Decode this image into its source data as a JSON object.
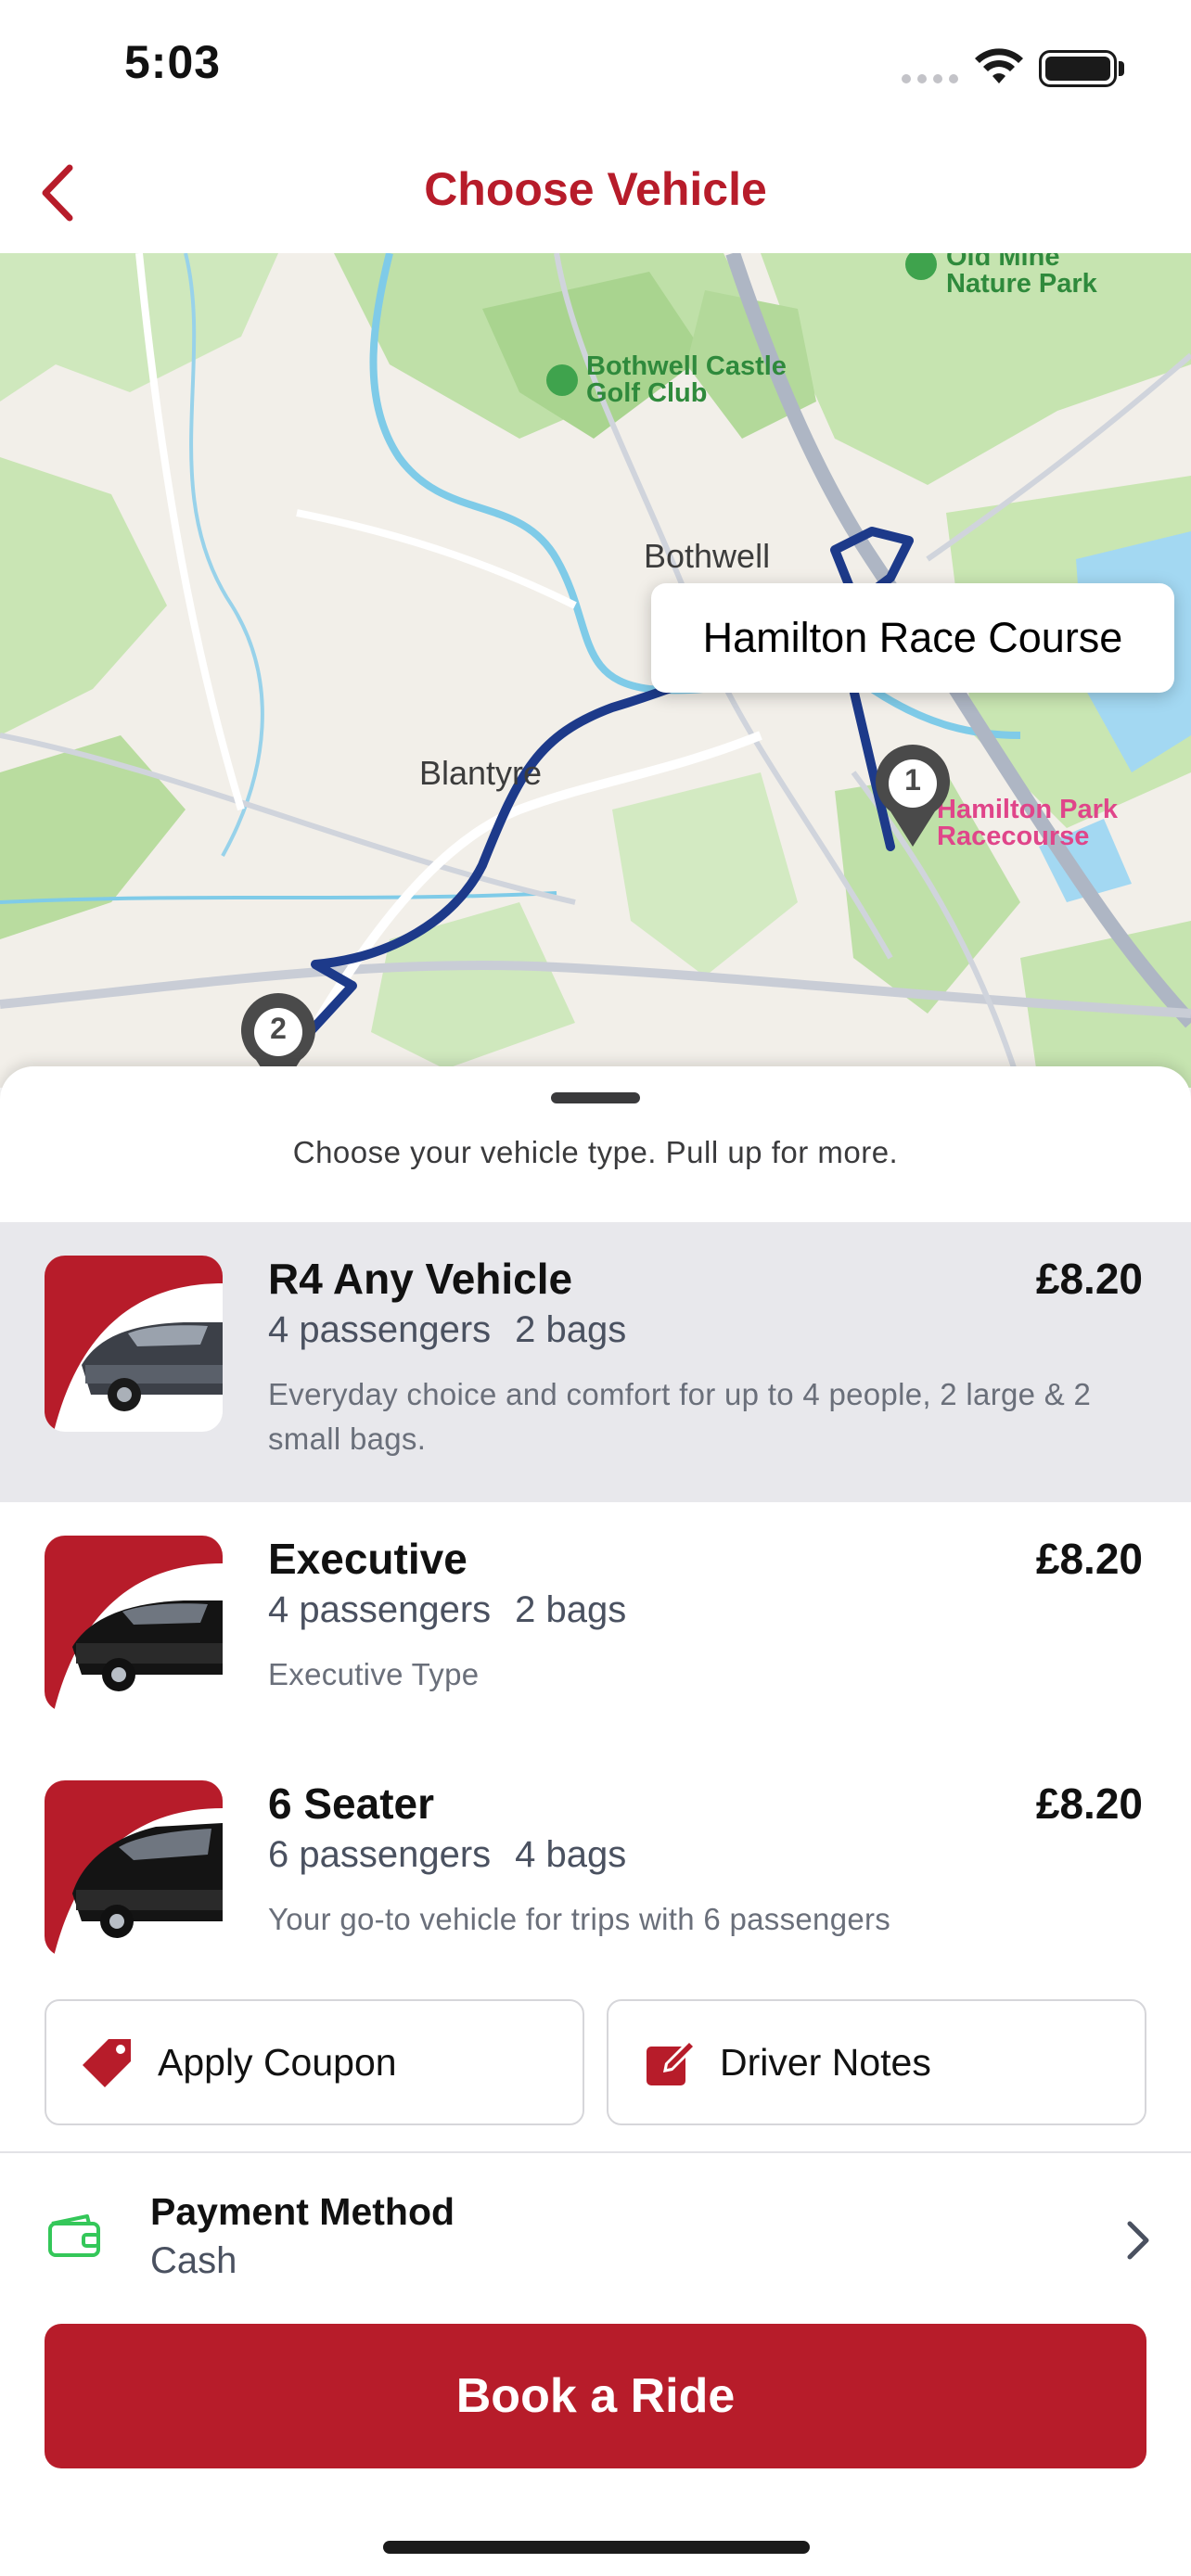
{
  "status_bar": {
    "time": "5:03"
  },
  "nav": {
    "title": "Choose Vehicle"
  },
  "map": {
    "labels": {
      "bothwell": "Bothwell",
      "blantyre": "Blantyre",
      "golf_club": "Bothwell Castle\nGolf Club",
      "nature_park": "Old Mine\nNature Park",
      "racecourse": "Hamilton Park\nRacecourse"
    },
    "callout": "Hamilton Race Course",
    "pins": {
      "start": "1",
      "end": "2"
    },
    "route_color": "#1d3a8a"
  },
  "sheet": {
    "hint": "Choose your vehicle type. Pull up for more."
  },
  "vehicles": [
    {
      "name": "R4 Any Vehicle",
      "price": "£8.20",
      "passengers": "4 passengers",
      "bags": "2 bags",
      "description": "Everyday choice and comfort for up to 4 people, 2 large & 2 small bags.",
      "selected": true
    },
    {
      "name": "Executive",
      "price": "£8.20",
      "passengers": "4 passengers",
      "bags": "2 bags",
      "description": "Executive Type",
      "selected": false
    },
    {
      "name": "6 Seater",
      "price": "£8.20",
      "passengers": "6 passengers",
      "bags": "4 bags",
      "description": "Your go-to vehicle for trips with 6 passengers",
      "selected": false
    }
  ],
  "actions": {
    "coupon": {
      "label": "Apply Coupon",
      "icon": "tag-icon"
    },
    "notes": {
      "label": "Driver Notes",
      "icon": "edit-note-icon"
    }
  },
  "payment": {
    "title": "Payment Method",
    "value": "Cash",
    "icon": "wallet-icon"
  },
  "book_button": {
    "label": "Book a Ride"
  },
  "colors": {
    "brand": "#b71c2a",
    "accent_green": "#34c759",
    "selected_row": "#e8e8ec"
  }
}
